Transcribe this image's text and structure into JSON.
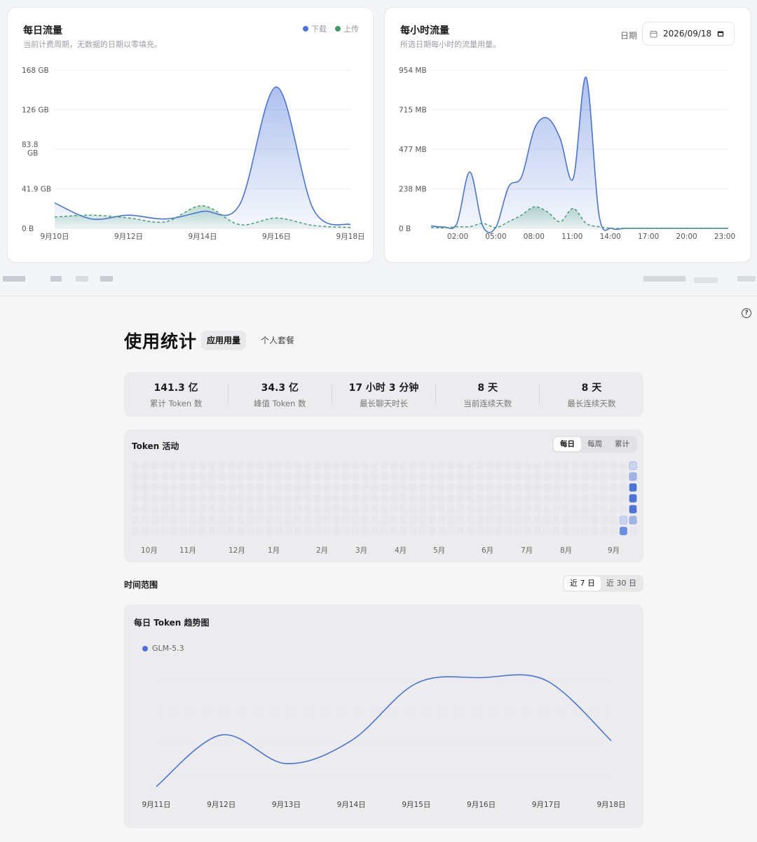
{
  "colors": {
    "download": "#4a74d9",
    "upload": "#3f9a6a",
    "accent": "#4a74d9",
    "heat_levels": [
      "#e8e8eb",
      "#c9d4f0",
      "#9fb3e6",
      "#6c8ee0",
      "#4a74d9"
    ]
  },
  "daily_traffic": {
    "title": "每日流量",
    "subtitle": "当前计费周期，无数据的日期以零填充。",
    "legend": {
      "download": "下载",
      "upload": "上传"
    },
    "chart_data": {
      "type": "area",
      "yticks": [
        "168 GB",
        "126 GB",
        "83.8 GB",
        "41.9 GB",
        "0 B"
      ],
      "ylim": [
        0,
        168
      ],
      "x_ticks": [
        "9月10日",
        "9月12日",
        "9月14日",
        "9月16日",
        "9月18日"
      ],
      "x": [
        "9月10日",
        "9月11日",
        "9月12日",
        "9月13日",
        "9月14日",
        "9月15日",
        "9月16日",
        "9月17日",
        "9月18日"
      ],
      "series": [
        {
          "name": "下载",
          "values": [
            27,
            10,
            14,
            10,
            18,
            25,
            150,
            20,
            4
          ]
        },
        {
          "name": "上传",
          "values": [
            12,
            14,
            11,
            7,
            24,
            4,
            11,
            3,
            1
          ]
        }
      ]
    }
  },
  "hourly_traffic": {
    "title": "每小时流量",
    "subtitle": "所选日期每小时的流量用量。",
    "date_label": "日期",
    "date_value": "2026/09/18",
    "chart_data": {
      "type": "area",
      "yticks": [
        "954 MB",
        "715 MB",
        "477 MB",
        "238 MB",
        "0 B"
      ],
      "ylim": [
        0,
        954
      ],
      "x_ticks": [
        "02:00",
        "05:00",
        "08:00",
        "11:00",
        "14:00",
        "17:00",
        "20:00",
        "23:00"
      ],
      "x": [
        0,
        1,
        2,
        3,
        4,
        5,
        6,
        7,
        8,
        9,
        10,
        11,
        12,
        13,
        14,
        15,
        16,
        17,
        18,
        19,
        20,
        21,
        22,
        23
      ],
      "series": [
        {
          "name": "下载",
          "values": [
            15,
            8,
            30,
            340,
            15,
            5,
            250,
            310,
            600,
            665,
            540,
            300,
            910,
            80,
            0,
            0,
            0,
            0,
            0,
            0,
            0,
            0,
            0,
            0
          ]
        },
        {
          "name": "上传",
          "values": [
            5,
            3,
            10,
            10,
            30,
            5,
            40,
            80,
            130,
            100,
            40,
            120,
            30,
            10,
            0,
            0,
            0,
            0,
            0,
            0,
            0,
            0,
            0,
            0
          ]
        }
      ]
    }
  },
  "usage": {
    "title": "使用统计",
    "tabs": [
      "应用用量",
      "个人套餐"
    ],
    "stats": [
      {
        "value": "141.3 亿",
        "label": "累计 Token 数"
      },
      {
        "value": "34.3 亿",
        "label": "峰值 Token 数"
      },
      {
        "value": "17 小时 3 分钟",
        "label": "最长聊天时长"
      },
      {
        "value": "8 天",
        "label": "当前连续天数"
      },
      {
        "value": "8 天",
        "label": "最长连续天数"
      }
    ],
    "activity": {
      "title": "Token 活动",
      "modes": [
        "每日",
        "每周",
        "累计"
      ],
      "months": [
        "10月",
        "11月",
        "12月",
        "1月",
        "2月",
        "3月",
        "4月",
        "5月",
        "6月",
        "7月",
        "8月",
        "9月"
      ],
      "active_cells": [
        {
          "week": 52,
          "day": 0,
          "level": 1
        },
        {
          "week": 52,
          "day": 1,
          "level": 2
        },
        {
          "week": 52,
          "day": 2,
          "level": 4
        },
        {
          "week": 52,
          "day": 3,
          "level": 4
        },
        {
          "week": 52,
          "day": 4,
          "level": 4
        },
        {
          "week": 51,
          "day": 5,
          "level": 1
        },
        {
          "week": 52,
          "day": 5,
          "level": 2
        },
        {
          "week": 51,
          "day": 6,
          "level": 3
        }
      ]
    },
    "range": {
      "label": "时间范围",
      "options": [
        "近 7 日",
        "近 30 日"
      ]
    },
    "trend": {
      "title": "每日 Token 趋势图",
      "chart_data": {
        "type": "line",
        "x": [
          "9月11日",
          "9月12日",
          "9月13日",
          "9月14日",
          "9月15日",
          "9月16日",
          "9月17日",
          "9月18日"
        ],
        "series": [
          {
            "name": "GLM-5.3",
            "values": [
              0.1,
              1.0,
              0.5,
              0.9,
              1.9,
              2.0,
              1.95,
              0.9
            ]
          }
        ]
      }
    }
  }
}
